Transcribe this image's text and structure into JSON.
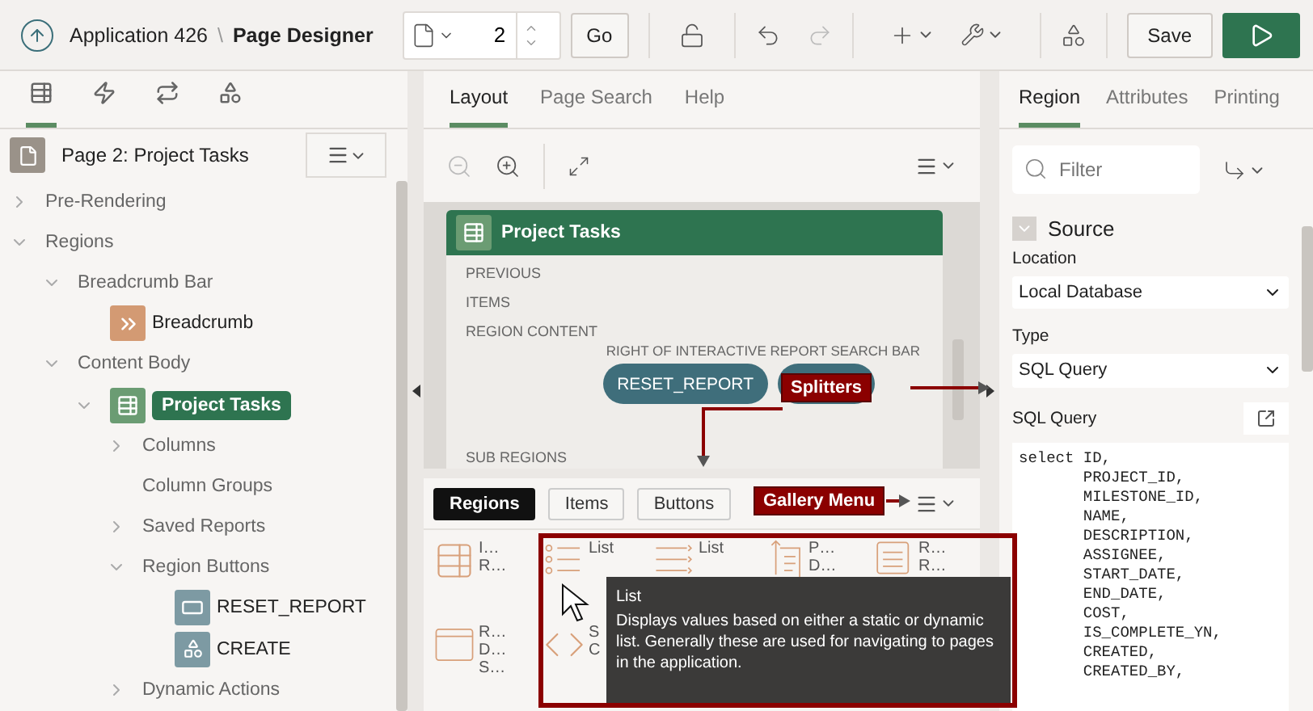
{
  "header": {
    "app": "Application 426",
    "separator": "\\",
    "page_title": "Page Designer",
    "page_number": "2",
    "go": "Go",
    "save": "Save"
  },
  "left_tabs": [
    {
      "kind": "rendering",
      "selected": true
    },
    {
      "kind": "dynamic-actions",
      "selected": false
    },
    {
      "kind": "processing",
      "selected": false
    },
    {
      "kind": "shared",
      "selected": false
    }
  ],
  "page_node": "Page 2: Project Tasks",
  "tree": [
    {
      "label": "Pre-Rendering",
      "expanded": false
    },
    {
      "label": "Regions",
      "expanded": true,
      "children": [
        {
          "label": "Breadcrumb Bar",
          "expanded": true,
          "children": [
            {
              "label": "Breadcrumb",
              "kind": "breadcrumb"
            }
          ]
        },
        {
          "label": "Content Body",
          "expanded": true,
          "children": [
            {
              "label": "Project Tasks",
              "kind": "report",
              "selected": true,
              "expanded": true,
              "children": [
                {
                  "label": "Columns",
                  "expanded": false
                },
                {
                  "label": "Column Groups"
                },
                {
                  "label": "Saved Reports",
                  "expanded": false
                },
                {
                  "label": "Region Buttons",
                  "expanded": true,
                  "children": [
                    {
                      "label": "RESET_REPORT",
                      "kind": "button"
                    },
                    {
                      "label": "CREATE",
                      "kind": "create-button"
                    }
                  ]
                },
                {
                  "label": "Dynamic Actions",
                  "expanded": false
                }
              ]
            }
          ]
        }
      ]
    }
  ],
  "middle_tabs": [
    {
      "label": "Layout",
      "selected": true
    },
    {
      "label": "Page Search",
      "selected": false
    },
    {
      "label": "Help",
      "selected": false
    }
  ],
  "canvas": {
    "title": "Project Tasks",
    "slots": [
      "PREVIOUS",
      "ITEMS",
      "REGION CONTENT"
    ],
    "right_slot": "RIGHT OF INTERACTIVE REPORT SEARCH BAR",
    "buttons": [
      "RESET_REPORT"
    ],
    "sub_regions": "SUB REGIONS"
  },
  "gallery": {
    "tabs": [
      {
        "label": "Regions",
        "selected": true
      },
      {
        "label": "Items",
        "selected": false
      },
      {
        "label": "Buttons",
        "selected": false
      }
    ],
    "items": [
      {
        "kind": "grid",
        "lines": [
          "I…",
          "R…"
        ]
      },
      {
        "kind": "list",
        "lines": [
          "List"
        ]
      },
      {
        "kind": "list-view",
        "lines": [
          "List"
        ]
      },
      {
        "kind": "pages",
        "lines": [
          "P…",
          "D…"
        ]
      },
      {
        "kind": "report",
        "lines": [
          "R…",
          "R…"
        ]
      },
      {
        "kind": "window",
        "lines": [
          "R…",
          "D…",
          "S…"
        ]
      },
      {
        "kind": "code",
        "lines": [
          "S",
          "C"
        ]
      }
    ]
  },
  "annotations": {
    "splitters": "Splitters",
    "gallery_menu": "Gallery Menu"
  },
  "tooltip": {
    "title": "List",
    "text": "Displays values based on either a static or dynamic list. Generally these are used for navigating to pages in the application."
  },
  "right_tabs": [
    {
      "label": "Region",
      "selected": true
    },
    {
      "label": "Attributes",
      "selected": false
    },
    {
      "label": "Printing",
      "selected": false
    }
  ],
  "filter_placeholder": "Filter",
  "source": {
    "heading": "Source",
    "location_label": "Location",
    "location": "Local Database",
    "type_label": "Type",
    "type": "SQL Query",
    "query_label": "SQL Query",
    "query": [
      "select ID,",
      "       PROJECT_ID,",
      "       MILESTONE_ID,",
      "       NAME,",
      "       DESCRIPTION,",
      "       ASSIGNEE,",
      "       START_DATE,",
      "       END_DATE,",
      "       COST,",
      "       IS_COMPLETE_YN,",
      "       CREATED,",
      "       CREATED_BY,"
    ]
  }
}
